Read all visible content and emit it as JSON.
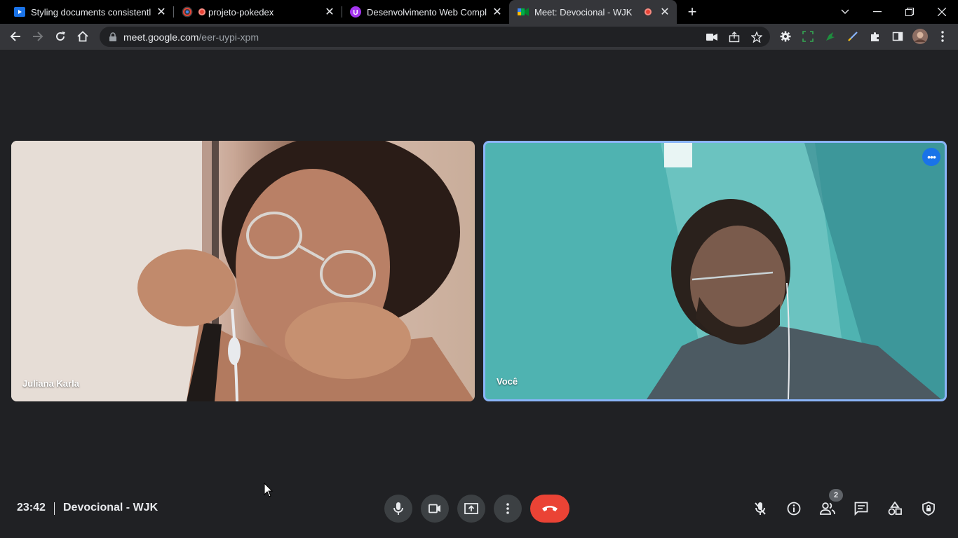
{
  "browser": {
    "tabs": [
      {
        "title": "Styling documents consistently",
        "favicon": "docs-play-icon",
        "color": "#4285f4"
      },
      {
        "title": "projeto-pokedex",
        "favicon": "github-icon",
        "color": "#ea4335",
        "recording": true
      },
      {
        "title": "Desenvolvimento Web Completo",
        "favicon": "udemy-icon",
        "color": "#a435f0"
      },
      {
        "title": "Meet: Devocional - WJK",
        "favicon": "meet-icon",
        "color": "#00832d",
        "active": true,
        "recording": true
      }
    ],
    "address": {
      "host": "meet.google.com",
      "path": "/eer-uypi-xpm"
    }
  },
  "meet": {
    "participants": [
      {
        "name": "Juliana Karla"
      },
      {
        "name": "Você",
        "highlighted": true
      }
    ],
    "time": "23:42",
    "meeting_name": "Devocional - WJK",
    "people_count": "2"
  },
  "colors": {
    "accent": "#8ab4f8",
    "hangup": "#ea4335",
    "active_speaker": "#1a73e8"
  }
}
